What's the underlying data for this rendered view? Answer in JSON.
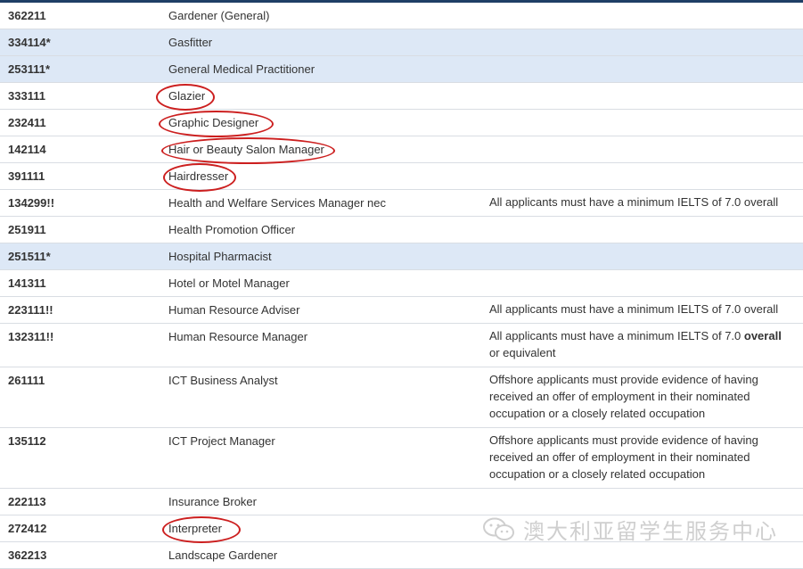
{
  "rows": [
    {
      "code": "362211",
      "occupation": "Gardener (General)",
      "note": "",
      "highlight": false,
      "circled": false
    },
    {
      "code": "334114*",
      "occupation": "Gasfitter",
      "note": "",
      "highlight": true,
      "circled": false
    },
    {
      "code": "253111*",
      "occupation": "General Medical Practitioner",
      "note": "",
      "highlight": true,
      "circled": false
    },
    {
      "code": "333111",
      "occupation": "Glazier",
      "note": "",
      "highlight": false,
      "circled": true
    },
    {
      "code": "232411",
      "occupation": "Graphic Designer",
      "note": "",
      "highlight": false,
      "circled": true
    },
    {
      "code": "142114",
      "occupation": "Hair or Beauty Salon Manager",
      "note": "",
      "highlight": false,
      "circled": true
    },
    {
      "code": "391111",
      "occupation": "Hairdresser",
      "note": "",
      "highlight": false,
      "circled": true
    },
    {
      "code": "134299!!",
      "occupation": "Health and Welfare Services Manager nec",
      "note": "All applicants must have a minimum IELTS of 7.0 overall",
      "highlight": false,
      "circled": false
    },
    {
      "code": "251911",
      "occupation": "Health Promotion Officer",
      "note": "",
      "highlight": false,
      "circled": false
    },
    {
      "code": "251511*",
      "occupation": "Hospital Pharmacist",
      "note": "",
      "highlight": true,
      "circled": false
    },
    {
      "code": "141311",
      "occupation": "Hotel or Motel Manager",
      "note": "",
      "highlight": false,
      "circled": false
    },
    {
      "code": "223111!!",
      "occupation": "Human Resource Adviser",
      "note": "All applicants must have a minimum IELTS of 7.0 overall",
      "highlight": false,
      "circled": false
    },
    {
      "code": "132311!!",
      "occupation": "Human Resource Manager",
      "note_pre": "All applicants must have a minimum IELTS of 7.0 ",
      "note_bold": "overall",
      "note_post": " or equivalent",
      "highlight": false,
      "circled": false
    },
    {
      "code": "261111",
      "occupation": "ICT Business Analyst",
      "note": "Offshore applicants must provide evidence of having received an offer of employment in their nominated occupation or a closely related occupation",
      "highlight": false,
      "circled": false
    },
    {
      "code": "135112",
      "occupation": "ICT Project Manager",
      "note": "Offshore applicants must  provide evidence of having received an offer of employment in their nominated occupation or a closely related occupation",
      "highlight": false,
      "circled": false
    },
    {
      "code": "222113",
      "occupation": "Insurance Broker",
      "note": "",
      "highlight": false,
      "circled": false
    },
    {
      "code": "272412",
      "occupation": "Interpreter",
      "note": "",
      "highlight": false,
      "circled": true
    },
    {
      "code": "362213",
      "occupation": "Landscape Gardener",
      "note": "",
      "highlight": false,
      "circled": false
    }
  ],
  "watermark": {
    "text": "澳大利亚留学生服务中心",
    "icon": "wechat-icon"
  },
  "colors": {
    "highlight": "#dde8f6",
    "circle": "#cc1f1f",
    "topbar": "#1f3f66"
  }
}
